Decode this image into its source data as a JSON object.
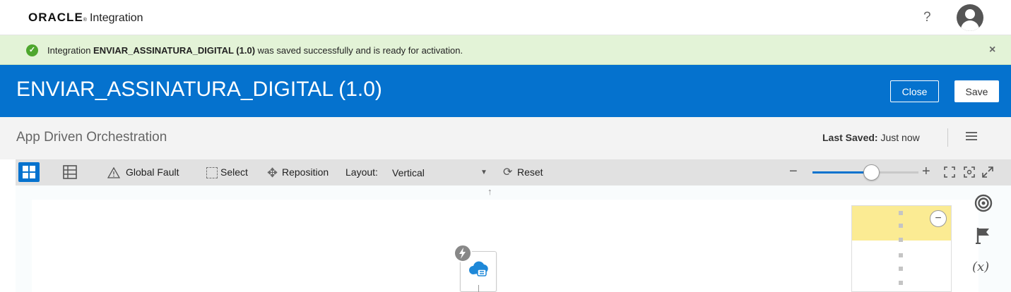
{
  "header": {
    "logo_brand": "ORACLE",
    "logo_product": "Integration",
    "help_label": "?"
  },
  "banner": {
    "prefix": "Integration ",
    "integration_name": "ENVIAR_ASSINATURA_DIGITAL (1.0)",
    "suffix": " was saved successfully and is ready for activation.",
    "close_label": "×"
  },
  "titlebar": {
    "title": "ENVIAR_ASSINATURA_DIGITAL (1.0)",
    "close_label": "Close",
    "save_label": "Save"
  },
  "subheader": {
    "pattern": "App Driven Orchestration",
    "last_saved_label": "Last Saved:",
    "last_saved_value": " Just now"
  },
  "toolbar": {
    "global_fault": "Global Fault",
    "select": "Select",
    "reposition": "Reposition",
    "layout_label": "Layout:",
    "layout_value": "Vertical",
    "reset": "Reset",
    "zoom_level": 0.55
  },
  "colors": {
    "brand_blue": "#0572ce",
    "success_bg": "#e3f3d7",
    "success_icon": "#4ea72e",
    "panel_highlight": "#fbeb93"
  },
  "right_rail_icons": [
    "target-icon",
    "flag-icon",
    "variable-icon"
  ],
  "variable_icon_label": "(x)"
}
